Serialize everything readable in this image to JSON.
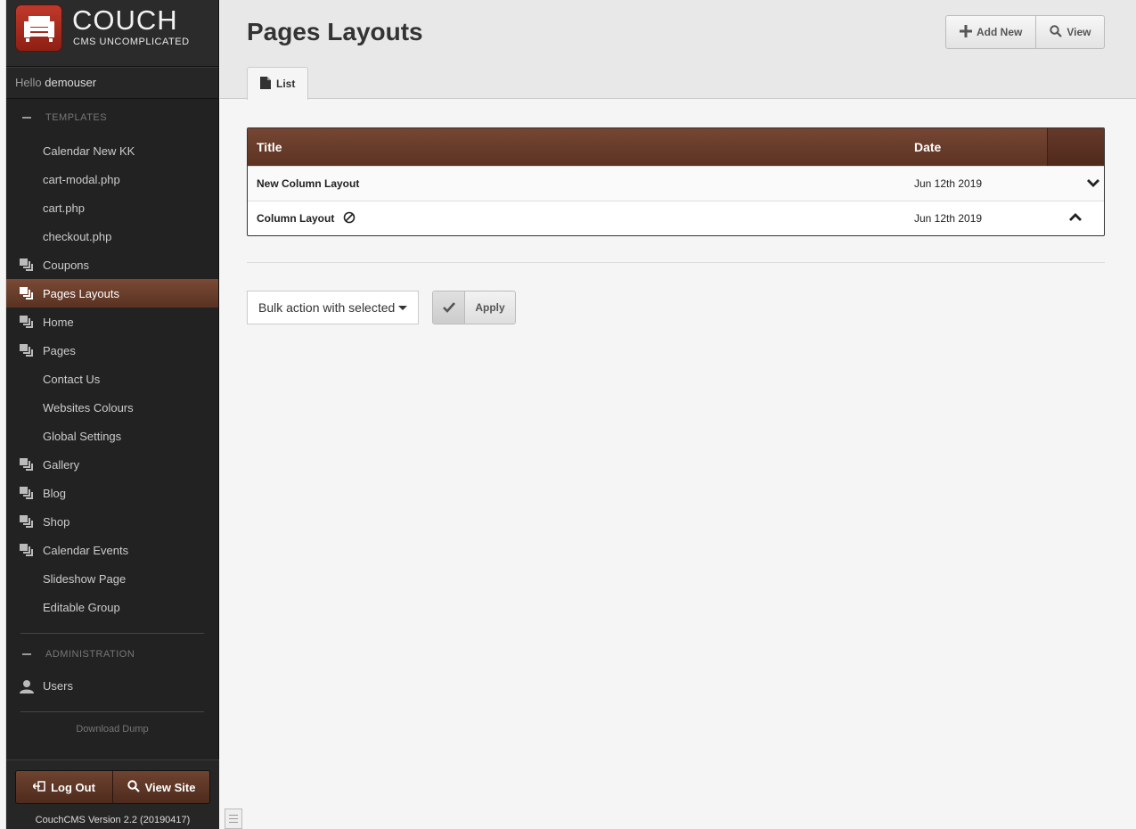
{
  "brand": {
    "name": "COUCH",
    "tagline": "CMS UNCOMPLICATED"
  },
  "greeting": {
    "hello": "Hello",
    "username": "demouser"
  },
  "sidebar": {
    "templates_heading": "TEMPLATES",
    "templates": [
      {
        "label": "Calendar New KK",
        "icon": "none"
      },
      {
        "label": "cart-modal.php",
        "icon": "none"
      },
      {
        "label": "cart.php",
        "icon": "none"
      },
      {
        "label": "checkout.php",
        "icon": "none"
      },
      {
        "label": "Coupons",
        "icon": "clone-icon"
      },
      {
        "label": "Pages Layouts",
        "icon": "clone-icon",
        "active": true
      },
      {
        "label": "Home",
        "icon": "clone-icon"
      },
      {
        "label": "Pages",
        "icon": "clone-icon"
      },
      {
        "label": "Contact Us",
        "icon": "none"
      },
      {
        "label": "Websites Colours",
        "icon": "none"
      },
      {
        "label": "Global Settings",
        "icon": "none"
      },
      {
        "label": "Gallery",
        "icon": "clone-icon"
      },
      {
        "label": "Blog",
        "icon": "clone-icon"
      },
      {
        "label": "Shop",
        "icon": "clone-icon"
      },
      {
        "label": "Calendar Events",
        "icon": "clone-icon"
      },
      {
        "label": "Slideshow Page",
        "icon": "none"
      },
      {
        "label": "Editable Group",
        "icon": "none"
      }
    ],
    "admin_heading": "ADMINISTRATION",
    "users_label": "Users",
    "download_dump": "Download Dump",
    "logout_label": "Log Out",
    "viewsite_label": "View Site",
    "version": "CouchCMS Version 2.2 (20190417)"
  },
  "main": {
    "title": "Pages Layouts",
    "add_new_label": "Add New",
    "view_label": "View",
    "tab_list_label": "List",
    "table": {
      "col_title": "Title",
      "col_date": "Date",
      "rows": [
        {
          "title": "New Column Layout",
          "date": "Jun 12th 2019",
          "blocked": false,
          "action": "chevron-down"
        },
        {
          "title": "Column Layout",
          "date": "Jun 12th 2019",
          "blocked": true,
          "action": "chevron-up"
        }
      ]
    },
    "bulk_action": "Bulk action with selected",
    "apply_label": "Apply"
  },
  "colors": {
    "accent_brown": "#6a3d2b",
    "sidebar_bg": "#222222",
    "logo_red": "#c0392b"
  }
}
